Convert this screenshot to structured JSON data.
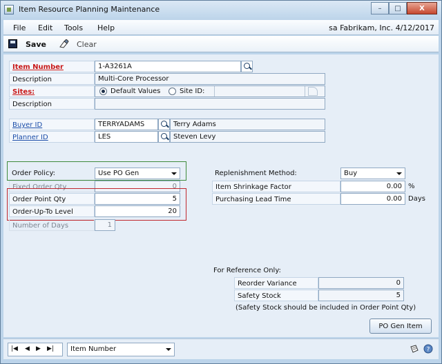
{
  "window": {
    "title": "Item Resource Planning Maintenance",
    "controls": {
      "minimize": "–",
      "maximize": "□",
      "close": "X"
    }
  },
  "menu": {
    "items": [
      "File",
      "Edit",
      "Tools",
      "Help"
    ],
    "company": "sa  Fabrikam, Inc.  4/12/2017"
  },
  "toolbar": {
    "save_label": "Save",
    "clear_label": "Clear"
  },
  "form": {
    "item_number": {
      "label": "Item Number",
      "value": "1-A3261A"
    },
    "description": {
      "label": "Description",
      "value": "Multi-Core Processor"
    },
    "sites": {
      "label": "Sites:",
      "opt_default": "Default Values",
      "opt_site": "Site ID:",
      "selected": "Default Values"
    },
    "site_description": {
      "label": "Description",
      "value": ""
    },
    "buyer": {
      "label": "Buyer ID",
      "value": "TERRYADAMS",
      "name": "Terry Adams"
    },
    "planner": {
      "label": "Planner ID",
      "value": "LES",
      "name": "Steven Levy"
    },
    "order_policy": {
      "label": "Order Policy:",
      "value": "Use PO Gen"
    },
    "fixed_order_qty": {
      "label": "Fixed Order Qty",
      "value": "0"
    },
    "order_point_qty": {
      "label": "Order Point Qty",
      "value": "5"
    },
    "order_up_to_level": {
      "label": "Order-Up-To Level",
      "value": "20"
    },
    "number_of_days": {
      "label": "Number of Days",
      "value": "1"
    },
    "replenishment_method": {
      "label": "Replenishment Method:",
      "value": "Buy"
    },
    "item_shrinkage_factor": {
      "label": "Item Shrinkage Factor",
      "value": "0.00",
      "unit": "%"
    },
    "purchasing_lead_time": {
      "label": "Purchasing Lead Time",
      "value": "0.00",
      "unit": "Days"
    },
    "reference": {
      "heading": "For Reference Only:",
      "reorder_variance": {
        "label": "Reorder Variance",
        "value": "0"
      },
      "safety_stock": {
        "label": "Safety Stock",
        "value": "5"
      },
      "note": "(Safety Stock should be included in Order Point Qty)"
    },
    "po_gen_button": "PO Gen Item"
  },
  "status": {
    "nav": [
      "|◀",
      "◀",
      "▶",
      "▶|"
    ],
    "sort_by": "Item Number"
  },
  "colors": {
    "highlight_green": "#3d8a3a",
    "highlight_red": "#c0272d",
    "required_label": "#c81818",
    "link_label": "#1a4ca8"
  }
}
